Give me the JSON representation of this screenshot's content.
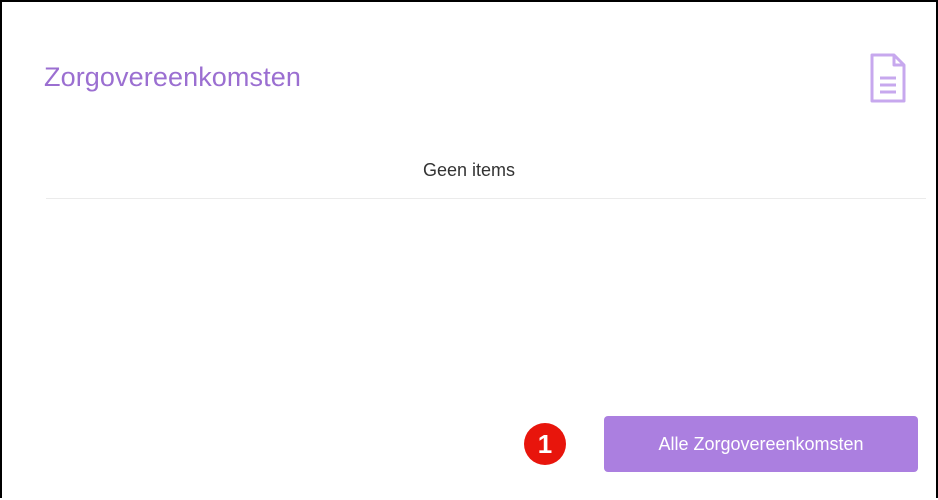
{
  "widget": {
    "title": "Zorgovereenkomsten",
    "empty_message": "Geen items",
    "all_button_label": "Alle Zorgovereenkomsten",
    "icon": "document-icon"
  },
  "annotation": {
    "step_number": "1"
  },
  "colors": {
    "accent": "#9b6fd1",
    "button": "#ab7fe0",
    "badge": "#e8150c"
  }
}
